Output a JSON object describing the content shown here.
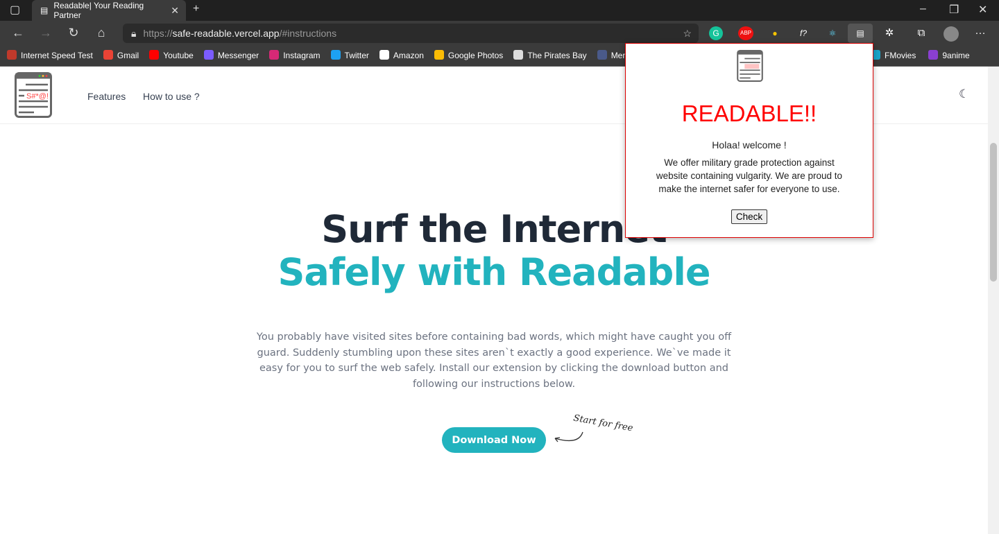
{
  "browser": {
    "tab_title": "Readable| Your Reading Partner",
    "url_scheme": "https://",
    "url_host": "safe-readable.vercel.app",
    "url_path": "/#instructions",
    "extensions": [
      "G",
      "ABP",
      "●",
      "f?",
      "⚛",
      "▤"
    ],
    "bookmarks": [
      {
        "label": "Internet Speed Test",
        "color": "#c0392b"
      },
      {
        "label": "Gmail",
        "color": "#ea4335"
      },
      {
        "label": "Youtube",
        "color": "#ff0000"
      },
      {
        "label": "Messenger",
        "color": "#7b5cff"
      },
      {
        "label": "Instagram",
        "color": "#d62976"
      },
      {
        "label": "Twitter",
        "color": "#1da1f2"
      },
      {
        "label": "Amazon",
        "color": "#ffffff"
      },
      {
        "label": "Google Photos",
        "color": "#fbbc05"
      },
      {
        "label": "The Pirates Bay",
        "color": "#dddddd"
      },
      {
        "label": "Mero S",
        "color": "#4a5a8a"
      }
    ],
    "bookmarks_right": [
      {
        "label": "FMovies",
        "color": "#1aa3c9"
      },
      {
        "label": "9anime",
        "color": "#8a3fd1"
      }
    ]
  },
  "site": {
    "logo_text": "S#*@!",
    "nav": [
      "Features",
      "How to use ?"
    ],
    "hero_line1": "Surf the Internet",
    "hero_line2": "Safely with Readable",
    "description": "You probably have visited sites before containing bad words, which might have caught you off guard. Suddenly stumbling upon these sites aren`t exactly a good experience. We`ve made it easy for you to surf the web safely. Install our extension by clicking the download button and following our instructions below.",
    "download_label": "Download Now",
    "annotation": "Start for free",
    "accent": "#22b3be"
  },
  "popup": {
    "title": "READABLE!!",
    "greeting": "Holaa! welcome !",
    "text": "We offer military grade protection against website containing vulgarity. We are proud to make the internet safer for everyone to use.",
    "button": "Check"
  }
}
